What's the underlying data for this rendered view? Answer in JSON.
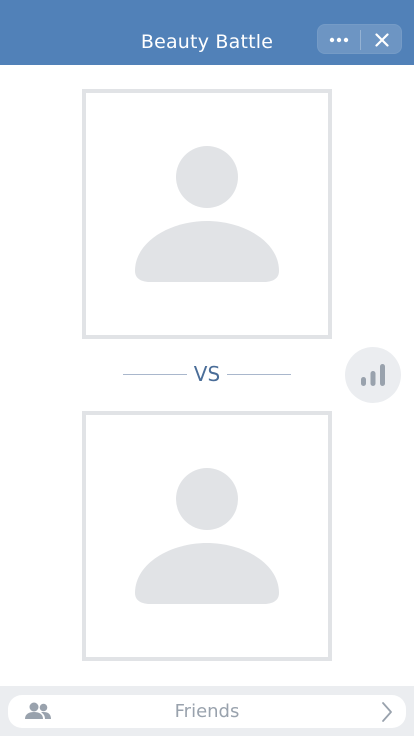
{
  "header": {
    "title": "Beauty Battle",
    "more_icon": "more-horizontal-icon",
    "close_icon": "close-icon",
    "background_color": "#5181b8"
  },
  "battle": {
    "top_photo_icon": "user-placeholder-icon",
    "bottom_photo_icon": "user-placeholder-icon",
    "vs_label": "VS",
    "stats_icon": "bar-chart-icon"
  },
  "bottom_bar": {
    "label": "Friends",
    "left_icon": "users-icon",
    "right_icon": "chevron-right-icon"
  }
}
